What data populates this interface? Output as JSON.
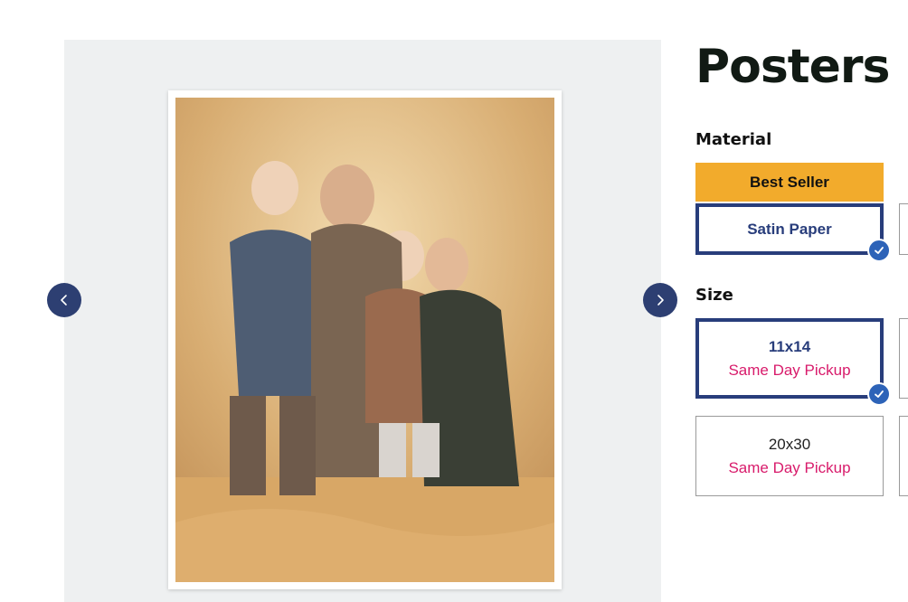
{
  "product": {
    "title": "Posters"
  },
  "gallery": {
    "prev_icon": "chevron-left-icon",
    "next_icon": "chevron-right-icon",
    "image_alt": "family-portrait-photo"
  },
  "material": {
    "label": "Material",
    "badge": "Best Seller",
    "options": [
      {
        "label": "Satin Paper",
        "selected": true
      }
    ]
  },
  "size": {
    "label": "Size",
    "options": [
      {
        "label": "11x14",
        "sub": "Same Day Pickup",
        "selected": true
      },
      {
        "label": "20x30",
        "sub": "Same Day Pickup",
        "selected": false
      }
    ]
  },
  "colors": {
    "brand_navy": "#283d7b",
    "badge_orange": "#f2ab2c",
    "pickup_pink": "#d81b6b",
    "check_blue": "#2d63b8"
  }
}
